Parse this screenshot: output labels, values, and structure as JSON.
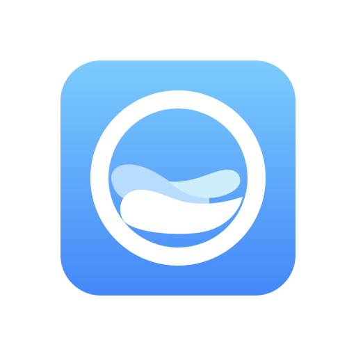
{
  "icon": {
    "name": "wave-ring-app-icon",
    "colors": {
      "background_top": "#7cccfd",
      "background_bottom": "#4487f8",
      "ring": "#ffffff",
      "wave_light": "#b8dcfb",
      "wave_lighter": "#cfeefb",
      "wave_white": "#ffffff"
    }
  }
}
